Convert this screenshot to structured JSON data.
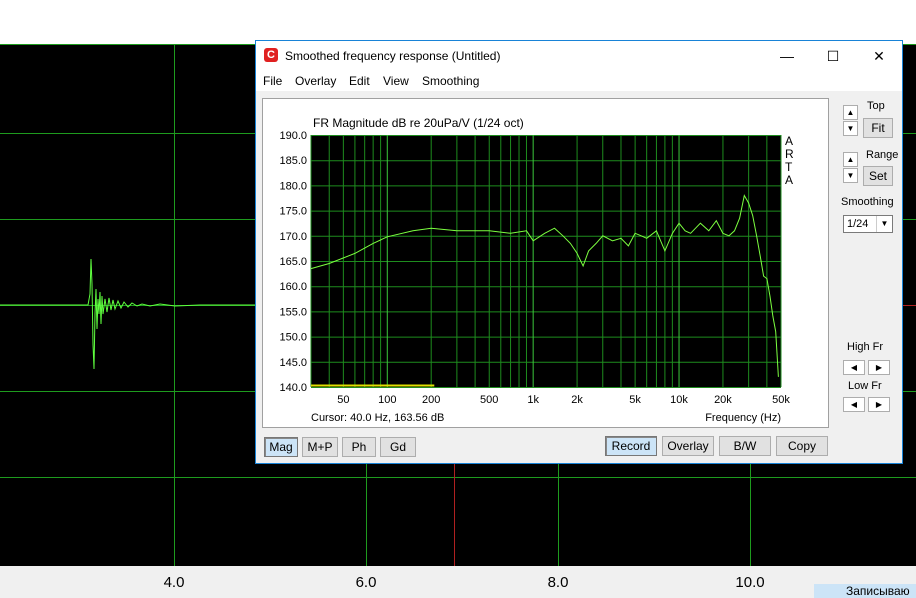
{
  "background": {
    "x_ticks": [
      "4.0",
      "6.0",
      "8.0",
      "10.0"
    ],
    "status_text": "Записываю"
  },
  "window": {
    "title": "Smoothed frequency response (Untitled)",
    "icon_letter": "C",
    "minimize": "—",
    "maximize": "☐",
    "close": "✕",
    "menu": [
      "File",
      "Overlay",
      "Edit",
      "View",
      "Smoothing"
    ]
  },
  "plot": {
    "side_letters": [
      "A",
      "R",
      "T",
      "A"
    ],
    "cursor_text": "Cursor: 40.0 Hz, 163.56 dB"
  },
  "chart_data": {
    "type": "line",
    "title": "FR Magnitude dB re 20uPa/V (1/24 oct)",
    "xlabel": "Frequency (Hz)",
    "ylabel": "",
    "x_scale": "log",
    "xlim": [
      30,
      50000
    ],
    "ylim": [
      140,
      190
    ],
    "grid": true,
    "yticks": [
      190,
      185,
      180,
      175,
      170,
      165,
      160,
      155,
      150,
      145,
      140
    ],
    "ytick_labels": [
      "190.0",
      "185.0",
      "180.0",
      "175.0",
      "170.0",
      "165.0",
      "160.0",
      "155.0",
      "150.0",
      "145.0",
      "140.0"
    ],
    "xticks": [
      50,
      100,
      200,
      500,
      1000,
      2000,
      5000,
      10000,
      20000,
      50000
    ],
    "xtick_labels": [
      "50",
      "100",
      "200",
      "500",
      "1k",
      "2k",
      "5k",
      "10k",
      "20k",
      "50k"
    ],
    "series": [
      {
        "color": "#7cff40",
        "x": [
          30,
          40,
          60,
          80,
          100,
          150,
          200,
          300,
          500,
          700,
          900,
          1000,
          1200,
          1400,
          1600,
          1800,
          2000,
          2200,
          2400,
          2700,
          3000,
          3500,
          4000,
          4500,
          5000,
          5500,
          6000,
          7000,
          8000,
          9000,
          10000,
          11000,
          12000,
          14000,
          16000,
          18000,
          20000,
          22000,
          24000,
          26000,
          28000,
          30000,
          32000,
          34000,
          36000,
          38000,
          40000,
          42000,
          44000,
          46000,
          48000
        ],
        "y": [
          163.5,
          164.5,
          166.5,
          168.5,
          169.8,
          171.0,
          171.5,
          171.0,
          171.0,
          170.5,
          171.0,
          169.0,
          170.5,
          171.5,
          170.0,
          168.5,
          166.5,
          164.0,
          167.0,
          168.5,
          170.0,
          169.0,
          169.5,
          168.0,
          170.5,
          170.0,
          169.5,
          171.0,
          167.0,
          170.5,
          172.5,
          171.0,
          170.5,
          172.5,
          171.0,
          173.0,
          170.5,
          170.0,
          171.0,
          173.5,
          178.0,
          176.5,
          174.0,
          170.0,
          166.0,
          162.0,
          161.5,
          158.0,
          154.0,
          151.0,
          142.0
        ]
      },
      {
        "color": "#e0e000",
        "x": [
          30,
          210
        ],
        "y": [
          140.3,
          140.3
        ]
      }
    ]
  },
  "buttons": {
    "bottom_left": [
      "Mag",
      "M+P",
      "Ph",
      "Gd"
    ],
    "bottom_right": [
      "Record",
      "Overlay",
      "B/W",
      "Copy"
    ],
    "top_label": "Top",
    "fit": "Fit",
    "range_label": "Range",
    "set": "Set",
    "smoothing_label": "Smoothing",
    "smoothing_value": "1/24",
    "high_fr": "High Fr",
    "low_fr": "Low Fr",
    "up": "▲",
    "down": "▼",
    "left": "◀",
    "right": "▶"
  }
}
